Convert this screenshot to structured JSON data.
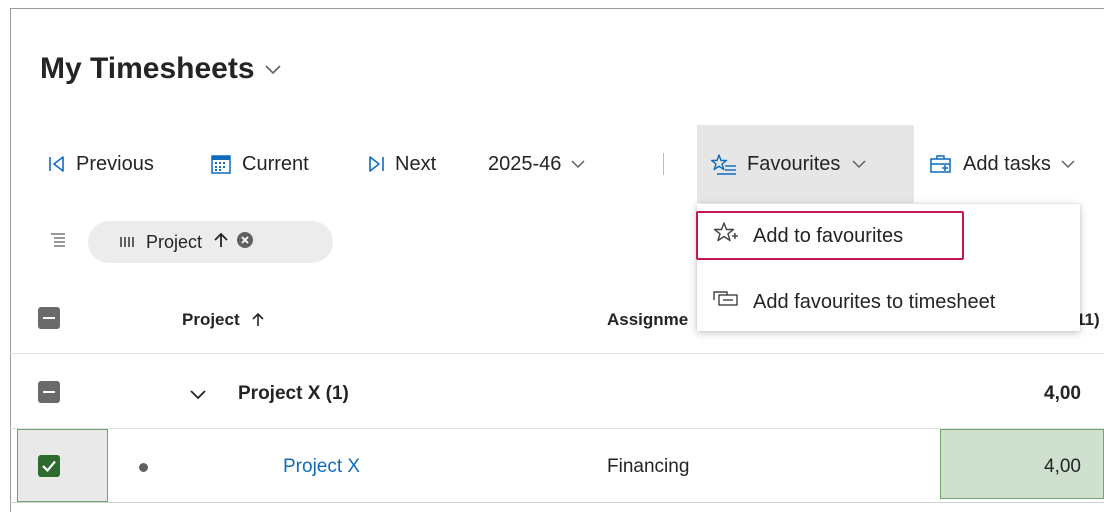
{
  "page": {
    "title": "My Timesheets"
  },
  "toolbar": {
    "previous_label": "Previous",
    "current_label": "Current",
    "next_label": "Next",
    "period_value": "2025-46",
    "favourites_label": "Favourites",
    "add_tasks_label": "Add tasks"
  },
  "grouping": {
    "pill_label": "Project"
  },
  "table": {
    "headers": {
      "project": "Project",
      "assignment": "Assignme",
      "total": "11)"
    },
    "group": {
      "label": "Project X",
      "count": "(1)",
      "total": "4,00"
    },
    "row": {
      "project": "Project X",
      "assignment": "Financing",
      "hours": "4,00"
    }
  },
  "favourites_menu": {
    "items": [
      {
        "label": "Add to favourites",
        "icon": "star-add-icon"
      },
      {
        "label": "Add favourites to timesheet",
        "icon": "tab-add-icon"
      }
    ]
  },
  "colors": {
    "accent_link": "#0f6cbd",
    "highlight_border": "#c5174f",
    "checkbox_checked": "#2f6b2f",
    "selected_cell": "#cfe0cf"
  }
}
